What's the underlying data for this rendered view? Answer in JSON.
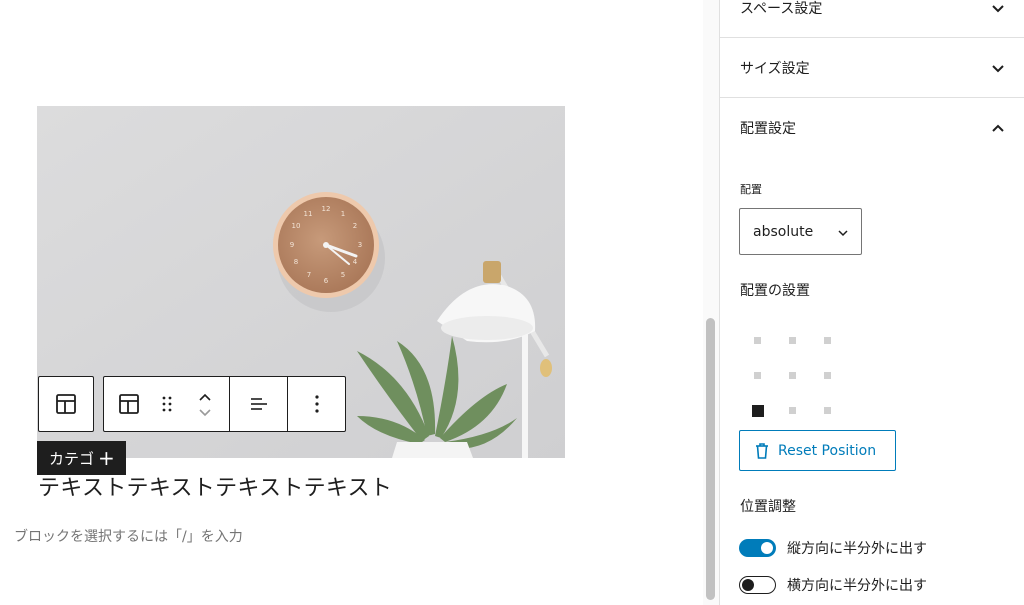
{
  "canvas": {
    "category_label": "カテゴ",
    "category_plus": "+",
    "block_text": "テキストテキストテキストテキスト",
    "appender_placeholder": "ブロックを選択するには「/」を入力"
  },
  "toolbar": {
    "parent_icon": "layout-icon",
    "block_icon": "layout-icon",
    "drag_icon": "drag-handle-icon",
    "move_up_icon": "chevron-up-icon",
    "move_down_icon": "chevron-down-icon",
    "align_icon": "align-left-icon",
    "more_icon": "more-vertical-icon"
  },
  "sidebar": {
    "panels": {
      "space": {
        "title": "スペース設定",
        "expanded": false
      },
      "size": {
        "title": "サイズ設定",
        "expanded": false
      },
      "position": {
        "title": "配置設定",
        "expanded": true
      }
    },
    "position_label": "配置",
    "position_select_value": "absolute",
    "placement_label": "配置の設置",
    "placement_grid_selected": "bottom-left",
    "reset_label": "Reset Position",
    "adjust_label": "位置調整",
    "toggles": [
      {
        "label": "縦方向に半分外に出す",
        "checked": true
      },
      {
        "label": "横方向に半分外に出す",
        "checked": false
      }
    ]
  },
  "colors": {
    "accent": "#007cba",
    "text": "#1e1e1e",
    "muted": "#757575",
    "border": "#e0e0e0"
  }
}
